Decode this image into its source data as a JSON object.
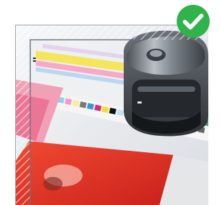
{
  "image": {
    "subject": "densitometer-on-print-color-bars-photo",
    "accent_color": "#2fb34a",
    "badge_icon": "checkmark-icon"
  }
}
